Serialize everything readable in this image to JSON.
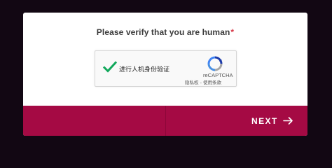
{
  "dialog": {
    "heading": "Please verify that you are human",
    "required_marker": "*"
  },
  "captcha": {
    "label": "进行人机身份验证",
    "brand": "reCAPTCHA",
    "links": "隐私权 - 使用条款",
    "icon": "checkmark-icon",
    "logo_icon": "recaptcha-logo-icon"
  },
  "footer": {
    "next_label": "NEXT",
    "next_icon": "arrow-right-icon"
  },
  "colors": {
    "background": "#120713",
    "card": "#ffffff",
    "accent": "#a50a44",
    "check": "#11a85b",
    "required": "#d83a4a"
  }
}
